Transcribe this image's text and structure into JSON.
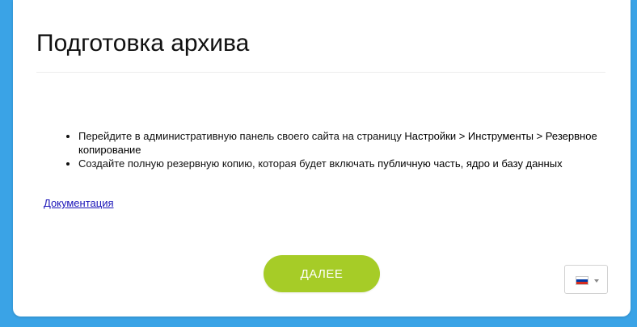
{
  "page": {
    "title": "Подготовка архива"
  },
  "instructions": {
    "items": [
      {
        "text": "Перейдите в административную панель своего сайта на страницу ",
        "strong": "Настройки > Инструменты > Резервное копирование"
      },
      {
        "text": "Создайте полную резервную копию, которая будет включать ",
        "strong": "публичную часть, ядро и базу данных"
      }
    ]
  },
  "documentation_link": "Документация",
  "next_button": "ДАЛЕЕ",
  "language": {
    "selected": "ru",
    "flag_colors": [
      "#ffffff",
      "#0039a6",
      "#d52b1e"
    ]
  },
  "colors": {
    "background": "#3aa3e6",
    "accent": "#a6cc27",
    "link": "#1a14b8"
  }
}
